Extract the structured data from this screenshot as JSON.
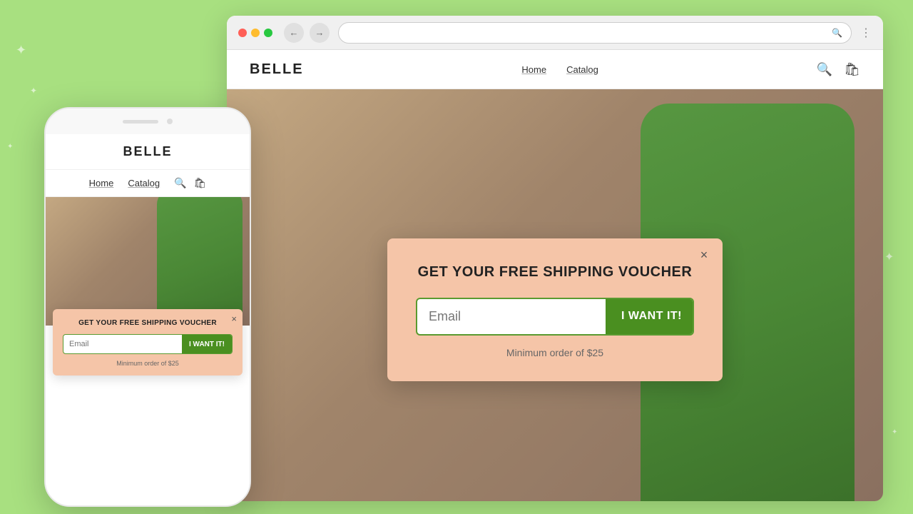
{
  "background": {
    "color": "#a8e080"
  },
  "browser": {
    "dots": [
      "red",
      "yellow",
      "green"
    ],
    "nav_back": "←",
    "nav_forward": "→",
    "address_placeholder": ""
  },
  "website": {
    "logo": "BELLE",
    "nav": {
      "home": "Home",
      "catalog": "Catalog"
    },
    "popup": {
      "title": "GET YOUR FREE SHIPPING VOUCHER",
      "email_placeholder": "Email",
      "submit_label": "I WANT IT!",
      "note": "Minimum order of $25",
      "close_label": "×"
    }
  },
  "mobile": {
    "logo": "BELLE",
    "nav": {
      "home": "Home",
      "catalog": "Catalog"
    },
    "popup": {
      "title": "GET YOUR FREE SHIPPING VOUCHER",
      "email_placeholder": "Email",
      "submit_label": "I WANT IT!",
      "note": "Minimum order of $25",
      "close_label": "×"
    }
  }
}
